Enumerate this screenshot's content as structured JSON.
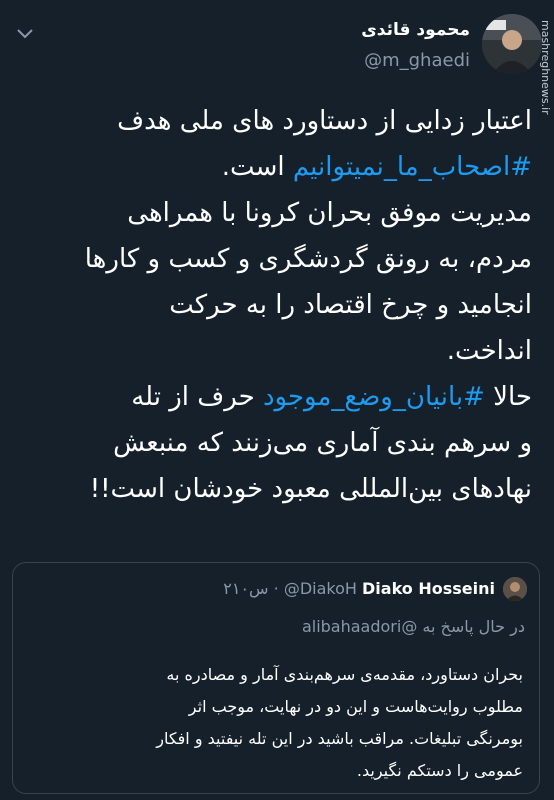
{
  "tweet": {
    "display_name": "محمود قائدی",
    "handle": "@m_ghaedi",
    "watermark": "mashreghnews.ir",
    "lines": [
      "اعتبار زدایی از دستاورد های ملی هدف",
      "اصحاب_ما_نمیتوانیم",
      "است.",
      "مدیریت موفق بحران کرونا با همراهی",
      "مردم، به رونق گردشگری و کسب و کارها",
      "انجامید و چرخ اقتصاد را به حرکت",
      "انداخت.",
      "حالا",
      "بانیان_وضع_موجود",
      "حرف از تله",
      "و سرهم بندی آماری می‌زنند که منبعش",
      "نهادهای بین‌المللی معبود خودشان است!!"
    ]
  },
  "quote": {
    "display_name": "Diako Hosseini",
    "handle": "@DiakoH",
    "time": "۲۱۰س",
    "reply_prefix": "در حال پاسخ به",
    "reply_to": "@alibahaadori",
    "lines": [
      "بحران دستاورد، مقدمه‌ی سرهم‌بندی آمار و مصادره به",
      "مطلوب روایت‌هاست و این دو در نهایت، موجب اثر",
      "بومرنگی تبلیغات. مراقب باشید در این تله نیفتید و افکار",
      "عمومی را دستکم نگیرید."
    ]
  },
  "colors": {
    "background": "#15202b",
    "text": "#ffffff",
    "secondary": "#8b98a5",
    "hashtag": "#1d9bf0",
    "border": "#38444d"
  }
}
